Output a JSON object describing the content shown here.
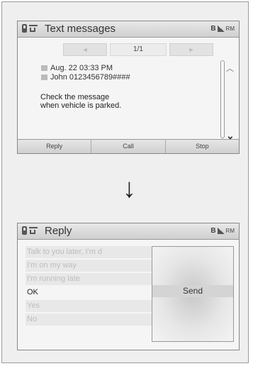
{
  "top_screen": {
    "title": "Text messages",
    "status_label": "B",
    "status_extra": "RM",
    "pager": {
      "prev": "◄",
      "count": "1/1",
      "next": "►"
    },
    "date": "Aug. 22 03:33 PM",
    "sender": "John 0123456789####",
    "message_line1": "Check the message",
    "message_line2": "when vehicle is parked.",
    "softkeys": [
      "Reply",
      "Call",
      "Stop"
    ]
  },
  "arrow": "↓",
  "bottom_screen": {
    "title": "Reply",
    "status_label": "B",
    "status_extra": "RM",
    "replies": [
      "Talk to you later, I'm d",
      "I'm on my way",
      "I'm running late",
      "OK",
      "Yes",
      "No"
    ],
    "selected_index": 3,
    "send_label": "Send"
  }
}
